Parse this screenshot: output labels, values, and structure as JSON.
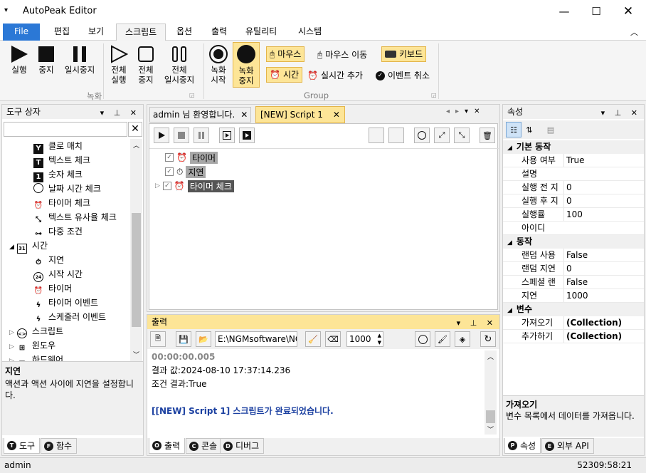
{
  "app": {
    "title": "AutoPeak Editor"
  },
  "ribbon_tabs": [
    "File",
    "편집",
    "보기",
    "스크립트",
    "옵션",
    "출력",
    "유틸리티",
    "시스템"
  ],
  "ribbon": {
    "rec_group_label": "녹화",
    "group_label": "Group",
    "run": "실행",
    "stop": "중지",
    "pause": "일시중지",
    "all_run": [
      "전체",
      "실행"
    ],
    "all_stop": [
      "전체",
      "중지"
    ],
    "all_pause": [
      "전체",
      "일시중지"
    ],
    "rec_start": [
      "녹화",
      "시작"
    ],
    "rec_stop": [
      "녹화",
      "중지"
    ],
    "mouse_click": "마우스",
    "mouse_move": "마우스 이동",
    "keyboard": "키보드",
    "time": "시간",
    "realtime_add": "실시간 추가",
    "event_cancel": "이벤트 취소"
  },
  "toolbox": {
    "title": "도구 상자",
    "items": [
      {
        "label": "클로 매치",
        "icon": "Y"
      },
      {
        "label": "텍스트 체크",
        "icon": "T"
      },
      {
        "label": "숫자 체크",
        "icon": "1"
      },
      {
        "label": "날짜 시간 체크",
        "icon": "clock"
      },
      {
        "label": "타이머 체크",
        "icon": "alarm"
      },
      {
        "label": "텍스트 유사율 체크",
        "icon": "similar"
      },
      {
        "label": "다중 조건",
        "icon": "multi"
      }
    ],
    "category_time": "시간",
    "category_time_icon": "31",
    "time_items": [
      {
        "label": "지연",
        "icon": "stopwatch"
      },
      {
        "label": "시작 시간",
        "icon": "24"
      },
      {
        "label": "타이머",
        "icon": "alarm"
      },
      {
        "label": "타이머 이벤트",
        "icon": "bolt"
      },
      {
        "label": "스케줄러 이벤트",
        "icon": "bolt"
      }
    ],
    "collapsed": [
      "스크립트",
      "윈도우",
      "하드웨어"
    ],
    "desc_title": "지연",
    "desc_text": "액션과 액션 사이에 지연을 설정합니다."
  },
  "doc_tabs": [
    "admin 님 환영합니다.",
    "[NEW] Script 1"
  ],
  "script_tree": [
    "타이머",
    "지연",
    "타이머 체크"
  ],
  "output": {
    "title": "출력",
    "path": "E:\\NGMsoftware\\NG",
    "count": "1000",
    "lines": [
      "00:00:00.005",
      "결과 값:2024-08-10 17:37:14.236",
      "조건 결과:True"
    ],
    "done": "[[NEW] Script 1] 스크립트가 완료되었습니다."
  },
  "bottom_tabs_left": [
    {
      "label": "도구",
      "key": "T"
    },
    {
      "label": "함수",
      "key": "F"
    }
  ],
  "bottom_tabs_center": [
    {
      "label": "출력",
      "key": "O"
    },
    {
      "label": "콘솔",
      "key": "C"
    },
    {
      "label": "디버그",
      "key": "D"
    }
  ],
  "bottom_tabs_right": [
    {
      "label": "속성",
      "key": "P"
    },
    {
      "label": "외부 API",
      "key": "E"
    }
  ],
  "properties": {
    "title": "속성",
    "cat_basic": "기본 동작",
    "basic": [
      [
        "사용 여부",
        "True"
      ],
      [
        "설명",
        ""
      ],
      [
        "실행 전 지",
        "0"
      ],
      [
        "실행 후 지",
        "0"
      ],
      [
        "실행률",
        "100"
      ],
      [
        "아이디",
        ""
      ]
    ],
    "cat_action": "동작",
    "action": [
      [
        "랜덤 사용",
        "False"
      ],
      [
        "랜덤 지연",
        "0"
      ],
      [
        "스페셜 랜",
        "False"
      ],
      [
        "지연",
        "1000"
      ]
    ],
    "cat_var": "변수",
    "var": [
      [
        "가져오기",
        "(Collection)"
      ],
      [
        "추가하기",
        "(Collection)"
      ]
    ],
    "desc_title": "가져오기",
    "desc_text": "변수 목록에서 데이터를 가져옵니다."
  },
  "status": {
    "user": "admin",
    "clock": "52309:58:21"
  }
}
